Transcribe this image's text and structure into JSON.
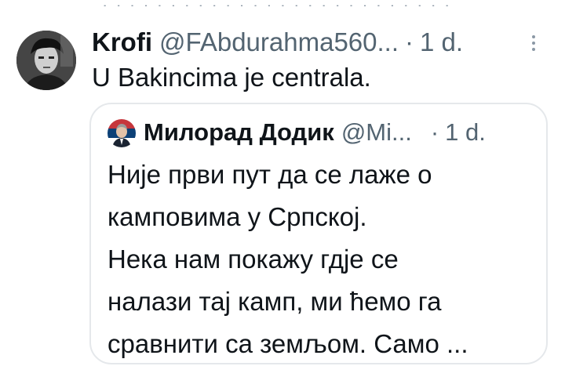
{
  "tweet": {
    "display_name": "Krofi",
    "handle": "@FAbdurahma560...",
    "separator": "·",
    "time": "1 d.",
    "text": "U Bakincima je centrala.",
    "more_icon": "vertical-ellipsis-icon",
    "avatar_icon": "profile-photo-avatar"
  },
  "quote": {
    "display_name": "Милорад Додик",
    "handle": "@Mi...",
    "separator": "·",
    "time": "1 d.",
    "avatar_icon": "flag-portrait-avatar",
    "lines": [
      "Није први пут да се лаже о",
      "камповима у Српској.",
      "Нека нам покажу гдје се",
      "налази тај камп, ми ћемо га",
      "сравнити са земљом. Само ..."
    ]
  },
  "colors": {
    "text": "#0f1419",
    "secondary": "#536471",
    "border": "#e5e8eb",
    "background": "#ffffff",
    "flag_red": "#c6363c",
    "flag_blue": "#0c4076"
  }
}
